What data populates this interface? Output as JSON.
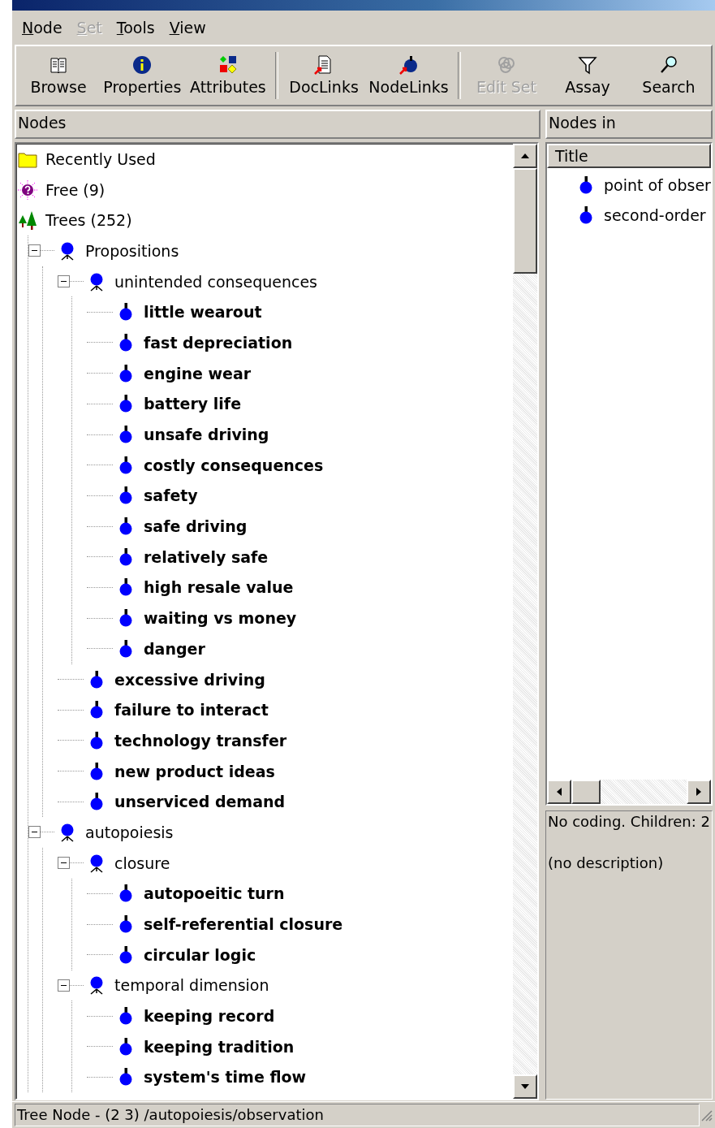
{
  "menu": [
    {
      "label": "Node",
      "disabled": false
    },
    {
      "label": "Set",
      "disabled": true
    },
    {
      "label": "Tools",
      "disabled": false
    },
    {
      "label": "View",
      "disabled": false
    }
  ],
  "toolbar": {
    "groups": [
      [
        {
          "label": "Browse",
          "disabled": false
        },
        {
          "label": "Properties",
          "disabled": false
        },
        {
          "label": "Attributes",
          "disabled": false
        }
      ],
      [
        {
          "label": "DocLinks",
          "disabled": false
        },
        {
          "label": "NodeLinks",
          "disabled": false
        }
      ],
      [
        {
          "label": "Edit Set",
          "disabled": true
        },
        {
          "label": "Assay",
          "disabled": false
        },
        {
          "label": "Search",
          "disabled": false
        }
      ]
    ]
  },
  "nodes_panel": {
    "title": "Nodes",
    "tree": [
      {
        "label": "Recently Used",
        "kind": "folder"
      },
      {
        "label": "Free (9)",
        "kind": "free"
      },
      {
        "label": "Trees (252)",
        "kind": "trees",
        "children": [
          {
            "label": "Propositions",
            "kind": "category",
            "expanded": true,
            "children": [
              {
                "label": "unintended consequences",
                "kind": "category",
                "expanded": true,
                "children": [
                  {
                    "label": "little wearout",
                    "kind": "node"
                  },
                  {
                    "label": "fast depreciation",
                    "kind": "node"
                  },
                  {
                    "label": "engine wear",
                    "kind": "node"
                  },
                  {
                    "label": "battery life",
                    "kind": "node"
                  },
                  {
                    "label": "unsafe driving",
                    "kind": "node"
                  },
                  {
                    "label": "costly consequences",
                    "kind": "node"
                  },
                  {
                    "label": "safety",
                    "kind": "node"
                  },
                  {
                    "label": "safe driving",
                    "kind": "node"
                  },
                  {
                    "label": "relatively safe",
                    "kind": "node"
                  },
                  {
                    "label": "high resale value",
                    "kind": "node"
                  },
                  {
                    "label": "waiting vs money",
                    "kind": "node"
                  },
                  {
                    "label": "danger",
                    "kind": "node"
                  }
                ]
              },
              {
                "label": "excessive driving",
                "kind": "node"
              },
              {
                "label": "failure to interact",
                "kind": "node"
              },
              {
                "label": "technology transfer",
                "kind": "node"
              },
              {
                "label": "new product ideas",
                "kind": "node"
              },
              {
                "label": "unserviced demand",
                "kind": "node"
              }
            ]
          },
          {
            "label": "autopoiesis",
            "kind": "category",
            "expanded": true,
            "children": [
              {
                "label": "closure",
                "kind": "category",
                "expanded": true,
                "children": [
                  {
                    "label": "autopoeitic turn",
                    "kind": "node"
                  },
                  {
                    "label": "self-referential closure",
                    "kind": "node"
                  },
                  {
                    "label": "circular logic",
                    "kind": "node"
                  }
                ]
              },
              {
                "label": "temporal dimension",
                "kind": "category",
                "expanded": true,
                "children": [
                  {
                    "label": "keeping record",
                    "kind": "node"
                  },
                  {
                    "label": "keeping tradition",
                    "kind": "node"
                  },
                  {
                    "label": "system's time flow",
                    "kind": "node"
                  }
                ]
              }
            ]
          }
        ]
      }
    ]
  },
  "nodes_in_panel": {
    "title": "Nodes in",
    "column": "Title",
    "rows": [
      "point of obser",
      "second-order"
    ],
    "info": [
      "No coding. Children: 2",
      "(no description)"
    ]
  },
  "status_bar": "Tree Node - (2 3) /autopoiesis/observation"
}
